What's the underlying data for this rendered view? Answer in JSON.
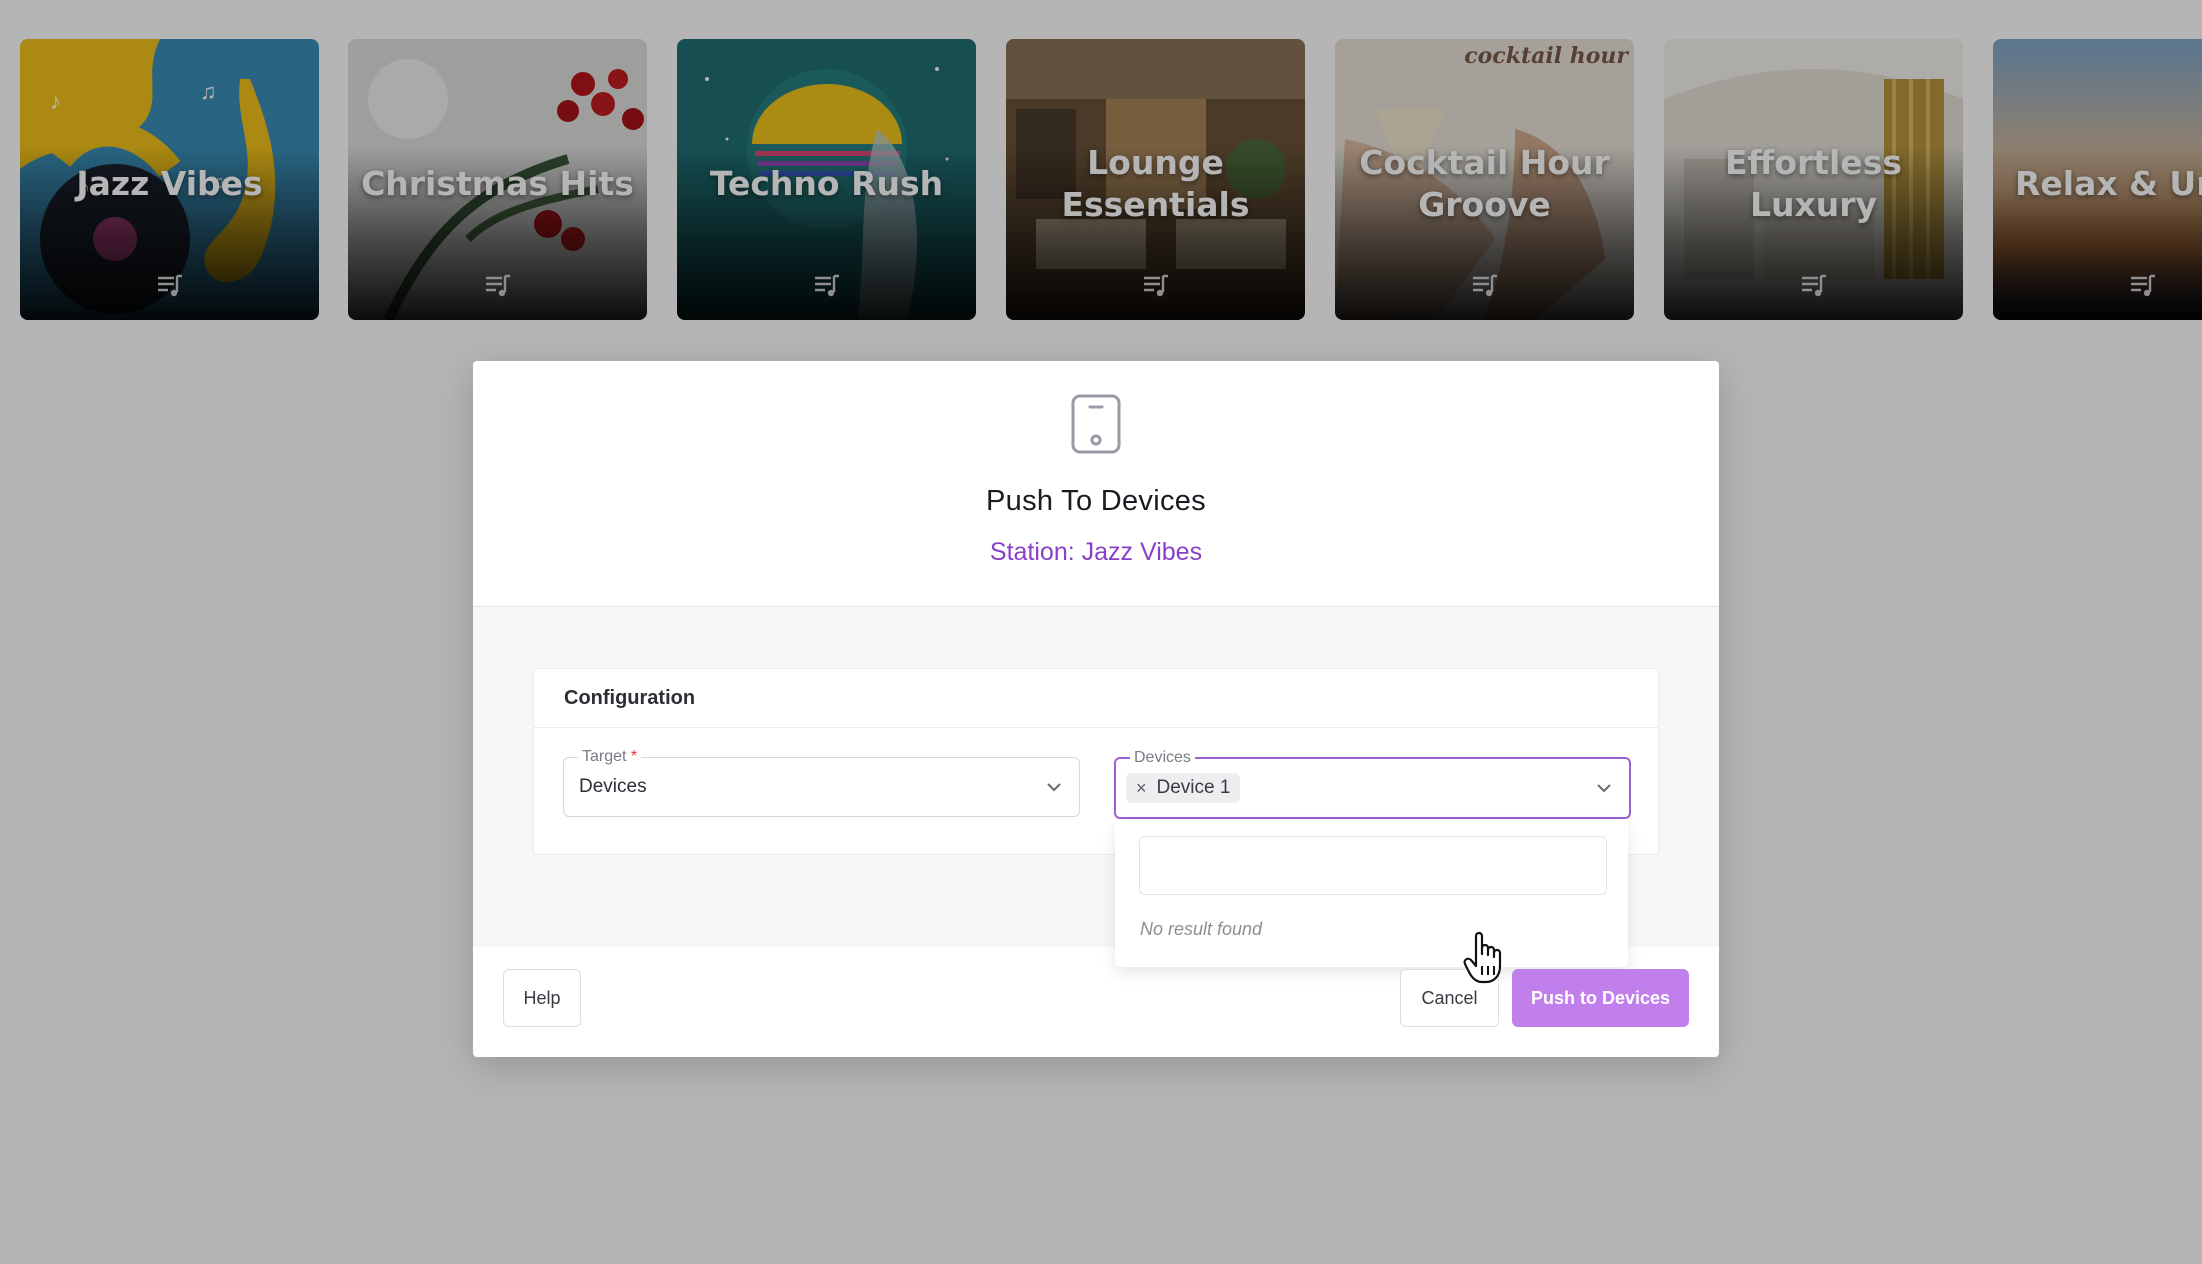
{
  "stations": [
    {
      "title": "Jazz Vibes",
      "icon": "queue-music-icon"
    },
    {
      "title": "Christmas Hits",
      "icon": "queue-music-icon"
    },
    {
      "title": "Techno Rush",
      "icon": "queue-music-icon"
    },
    {
      "title": "Lounge\nEssentials",
      "icon": "queue-music-icon"
    },
    {
      "title": "Cocktail Hour\nGroove",
      "tagline": "cocktail hour",
      "icon": "queue-music-icon"
    },
    {
      "title": "Effortless\nLuxury",
      "icon": "queue-music-icon"
    },
    {
      "title": "Relax & Unw",
      "icon": "queue-music-icon"
    }
  ],
  "modal": {
    "icon": "mobile-device-icon",
    "title": "Push To Devices",
    "subtitle": "Station: Jazz Vibes",
    "config_title": "Configuration",
    "target": {
      "label": "Target",
      "required_mark": "*",
      "value": "Devices"
    },
    "devices": {
      "label": "Devices",
      "chips": [
        {
          "label": "Device 1",
          "remove": "×"
        }
      ],
      "search_placeholder": "",
      "empty_text": "No result found"
    },
    "buttons": {
      "help": "Help",
      "cancel": "Cancel",
      "push": "Push to Devices"
    }
  },
  "colors": {
    "accent": "#8a3fc9",
    "primary_button": "#c17fec",
    "focus_border": "#9c5fd6",
    "overlay": "rgba(0,0,0,0.29)"
  }
}
